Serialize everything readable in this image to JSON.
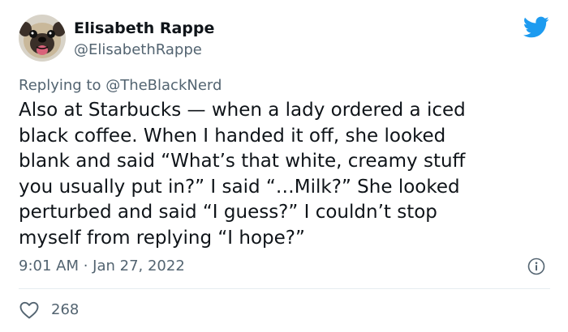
{
  "author": {
    "name": "Elisabeth Rappe",
    "handle": "@ElisabethRappe",
    "avatar_icon": "pug-avatar"
  },
  "reply": {
    "prefix": "Replying to ",
    "mention": "@TheBlackNerd"
  },
  "tweet": {
    "text": "Also at Starbucks — when a lady ordered a iced\nblack coffee. When I handed it off, she looked\nblank and said “What’s that white, creamy stuff\nyou usually put in?” I said “…Milk?” She looked\nperturbed and said “I guess?”  I couldn’t stop\nmyself from replying “I hope?”",
    "timestamp": "9:01 AM · Jan 27, 2022"
  },
  "engagement": {
    "likes": "268"
  },
  "icons": {
    "platform": "twitter-bird-icon",
    "info": "info-icon",
    "like": "heart-icon"
  },
  "colors": {
    "brand": "#1d9bf0",
    "text_primary": "#0f1419",
    "text_secondary": "#536471",
    "divider": "#e6ecf0"
  }
}
